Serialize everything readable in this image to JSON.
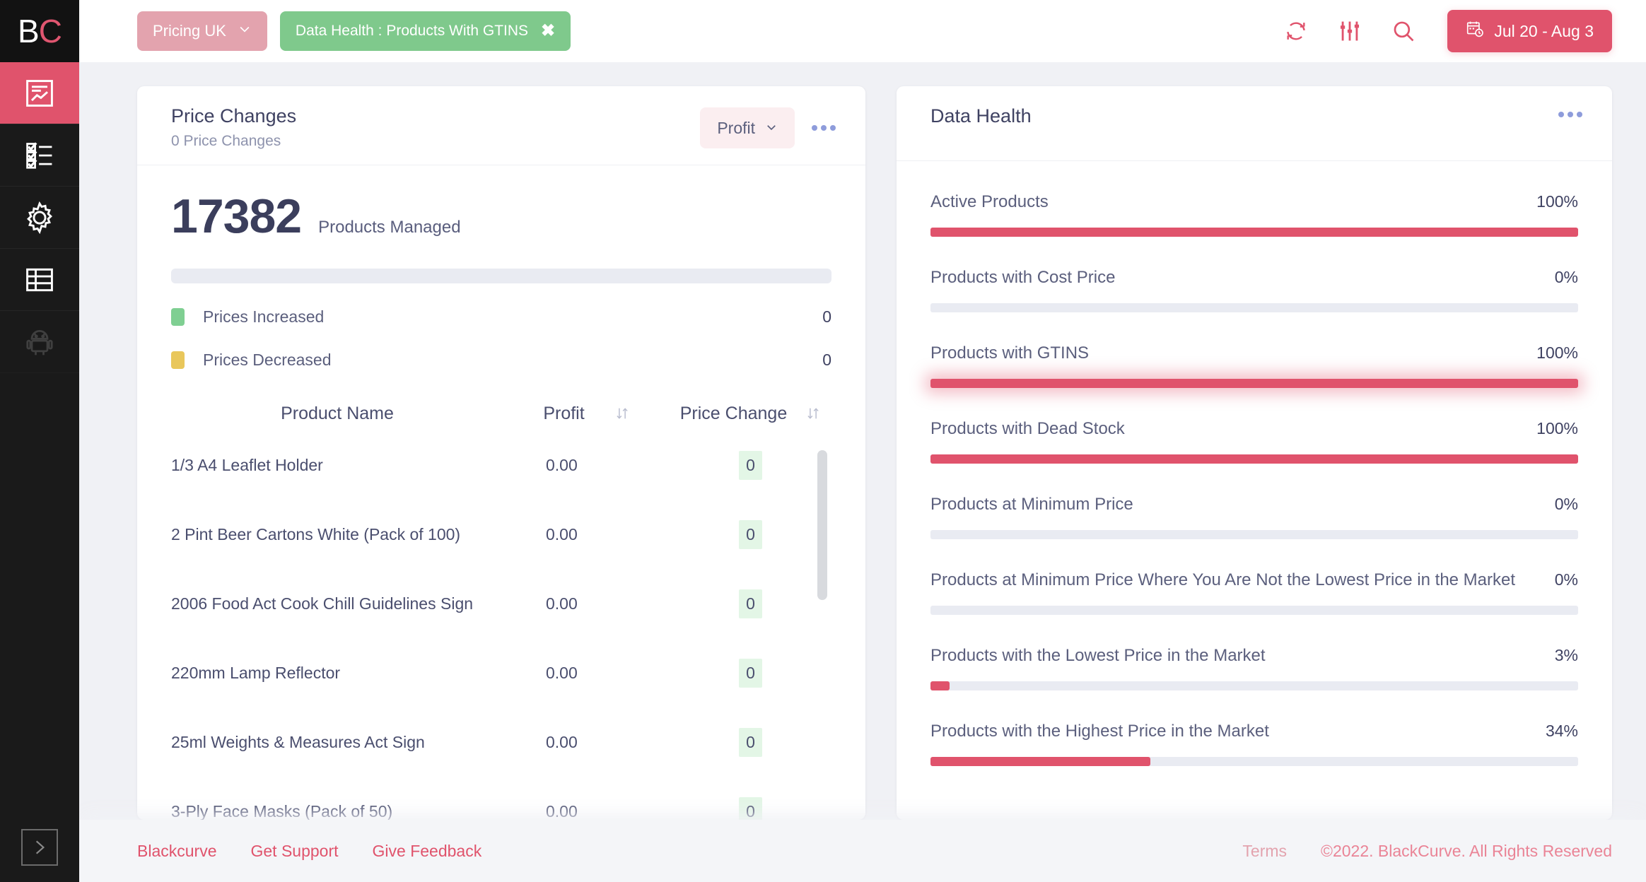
{
  "brand": {
    "name_part1": "B",
    "name_part2": "C",
    "accent": "#e0536c"
  },
  "sidebar": {
    "items": [
      {
        "label": "Dashboard",
        "icon": "report-chart-icon",
        "active": true
      },
      {
        "label": "Rules",
        "icon": "checklist-icon",
        "active": false
      },
      {
        "label": "Settings",
        "icon": "gear-icon",
        "active": false
      },
      {
        "label": "Data Table",
        "icon": "table-icon",
        "active": false
      },
      {
        "label": "Automation",
        "icon": "robot-icon",
        "active": false
      }
    ],
    "expand_icon": "chevron-right-icon"
  },
  "topbar": {
    "pricing_chip": "Pricing UK",
    "pricing_caret": "chevron-down-icon",
    "filter_chip": "Data Health : Products With GTINS",
    "filter_close": "✖",
    "refresh_icon": "refresh-icon",
    "sliders_icon": "filter-sliders-icon",
    "search_icon": "search-icon",
    "date_icon": "calendar-clock-icon",
    "date_range": "Jul 20 - Aug 3"
  },
  "price_changes": {
    "title": "Price Changes",
    "subtitle": "0 Price Changes",
    "metric_select": "Profit",
    "metric_caret": "chevron-down-icon",
    "more_menu": "more-options-icon",
    "kpi_value": "17382",
    "kpi_label": "Products Managed",
    "legend": [
      {
        "label": "Prices Increased",
        "value": "0",
        "color": "#7fcf92"
      },
      {
        "label": "Prices Decreased",
        "value": "0",
        "color": "#e9c75b"
      }
    ],
    "columns": [
      {
        "label": "Product Name",
        "sortable": false
      },
      {
        "label": "Profit",
        "sortable": true
      },
      {
        "label": "Price Change",
        "sortable": true
      }
    ],
    "rows": [
      {
        "name": "1/3 A4 Leaflet Holder",
        "profit": "0.00",
        "change": "0"
      },
      {
        "name": "2 Pint Beer Cartons White (Pack of 100)",
        "profit": "0.00",
        "change": "0"
      },
      {
        "name": "2006 Food Act Cook Chill Guidelines Sign",
        "profit": "0.00",
        "change": "0"
      },
      {
        "name": "220mm Lamp Reflector",
        "profit": "0.00",
        "change": "0"
      },
      {
        "name": "25ml Weights & Measures Act Sign",
        "profit": "0.00",
        "change": "0"
      },
      {
        "name": "3-Ply Face Masks (Pack of 50)",
        "profit": "0.00",
        "change": "0"
      }
    ]
  },
  "data_health": {
    "title": "Data Health",
    "more_menu": "more-options-icon",
    "items": [
      {
        "label": "Active Products",
        "pct_label": "100%",
        "pct": 100,
        "highlight": false
      },
      {
        "label": "Products with Cost Price",
        "pct_label": "0%",
        "pct": 0,
        "highlight": false
      },
      {
        "label": "Products with GTINS",
        "pct_label": "100%",
        "pct": 100,
        "highlight": true
      },
      {
        "label": "Products with Dead Stock",
        "pct_label": "100%",
        "pct": 100,
        "highlight": false
      },
      {
        "label": "Products at Minimum Price",
        "pct_label": "0%",
        "pct": 0,
        "highlight": false
      },
      {
        "label": "Products at Minimum Price Where You Are Not the Lowest Price in the Market",
        "pct_label": "0%",
        "pct": 0,
        "highlight": false
      },
      {
        "label": "Products with the Lowest Price in the Market",
        "pct_label": "3%",
        "pct": 3,
        "highlight": false
      },
      {
        "label": "Products with the Highest Price in the Market",
        "pct_label": "34%",
        "pct": 34,
        "highlight": false
      }
    ]
  },
  "footer": {
    "links": [
      "Blackcurve",
      "Get Support",
      "Give Feedback"
    ],
    "terms": "Terms",
    "copyright": "©2022. BlackCurve. All Rights Reserved"
  }
}
